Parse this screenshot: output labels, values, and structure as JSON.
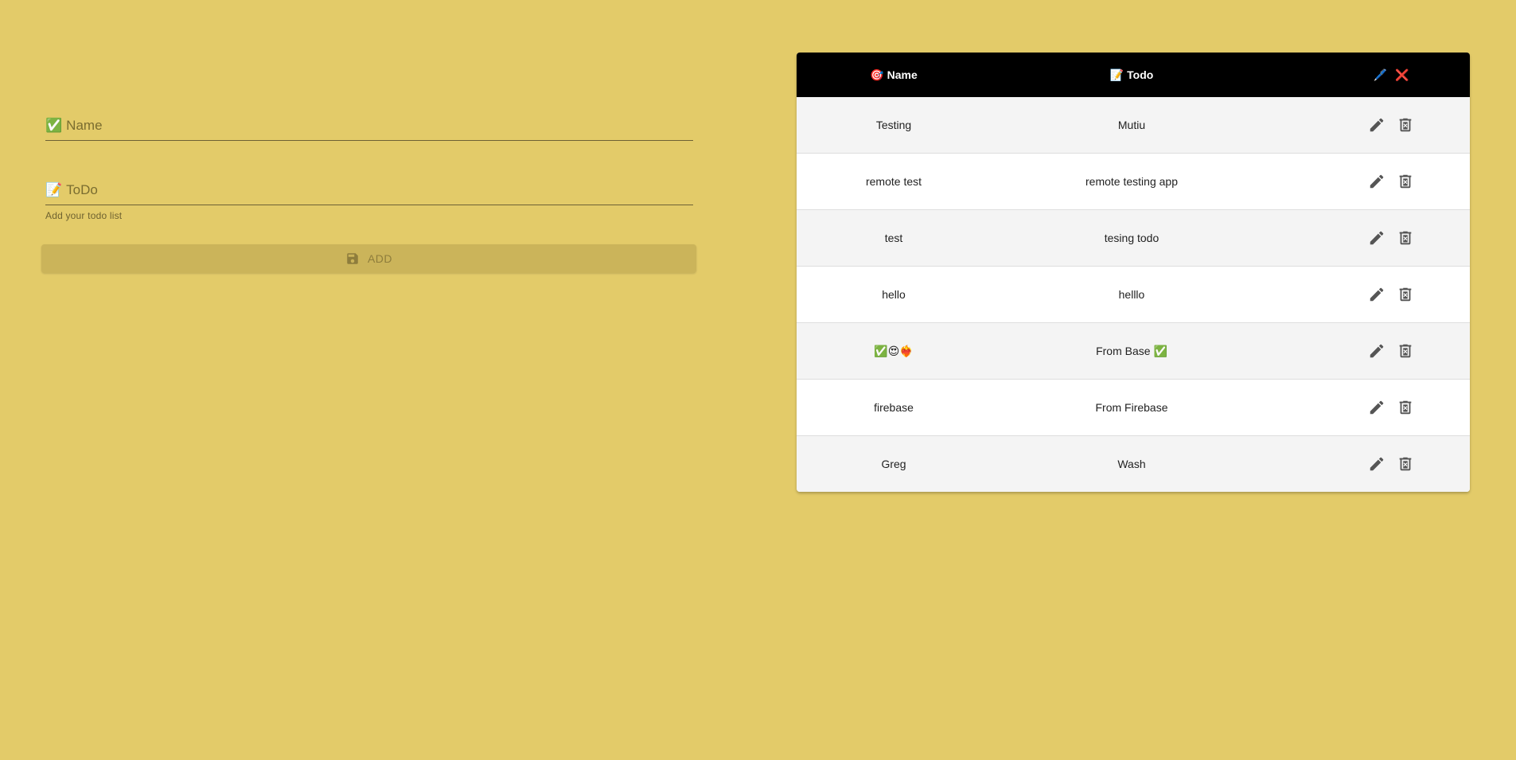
{
  "form": {
    "name_emoji": "✅",
    "name_placeholder": "Name",
    "todo_emoji": "📝",
    "todo_placeholder": "ToDo",
    "todo_helper": "Add your todo list",
    "add_label": "ADD"
  },
  "table": {
    "header": {
      "name_emoji": "🎯",
      "name_label": "Name",
      "todo_emoji": "📝",
      "todo_label": "Todo",
      "edit_emoji": "🖊️",
      "delete_emoji": "❌"
    },
    "rows": [
      {
        "name": "Testing",
        "todo": "Mutiu"
      },
      {
        "name": "remote test",
        "todo": "remote testing app"
      },
      {
        "name": "test",
        "todo": "tesing todo"
      },
      {
        "name": "hello",
        "todo": "helllo"
      },
      {
        "name": "✅😍❤️‍🔥",
        "todo": "From Base ✅"
      },
      {
        "name": "firebase",
        "todo": "From Firebase"
      },
      {
        "name": "Greg",
        "todo": "Wash"
      }
    ]
  },
  "colors": {
    "background": "#e3cb69",
    "header_bg": "#000000",
    "button_bg": "#cbb45a",
    "icon": "#555555"
  },
  "icons": {
    "edit": "pencil-icon",
    "delete": "trash-x-icon",
    "save": "floppy-disk-icon"
  }
}
